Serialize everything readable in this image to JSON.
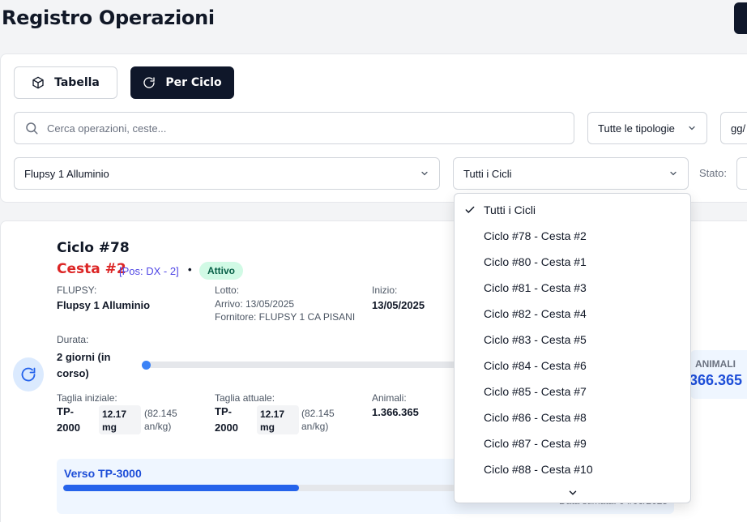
{
  "page_title": "Registro Operazioni",
  "view_toggle": {
    "table_label": "Tabella",
    "cycle_label": "Per Ciclo"
  },
  "filters": {
    "search_placeholder": "Cerca operazioni, ceste...",
    "type_select": "Tutte le tipologie",
    "date_field": "gg/",
    "flupsy_select": "Flupsy 1 Alluminio",
    "cycle_select": "Tutti i Cicli",
    "state_label": "Stato:"
  },
  "cycle_dropdown": {
    "selected": "Tutti i Cicli",
    "options": [
      "Tutti i Cicli",
      "Ciclo #78 - Cesta #2",
      "Ciclo #80 - Cesta #1",
      "Ciclo #81 - Cesta #3",
      "Ciclo #82 - Cesta #4",
      "Ciclo #83 - Cesta #5",
      "Ciclo #84 - Cesta #6",
      "Ciclo #85 - Cesta #7",
      "Ciclo #86 - Cesta #8",
      "Ciclo #87 - Cesta #9",
      "Ciclo #88 - Cesta #10"
    ]
  },
  "cycle_card": {
    "title": "Ciclo #78",
    "basket": "Cesta #2",
    "position": "[Pos: DX - 2]",
    "separator": "•",
    "status": "Attivo",
    "flupsy_label": "FLUPSY:",
    "flupsy_value": "Flupsy 1 Alluminio",
    "lot_label": "Lotto:",
    "lot_arrival": "Arrivo: 13/05/2025",
    "lot_supplier": "Fornitore: FLUPSY 1 CA PISANI",
    "start_label": "Inizio:",
    "start_value": "13/05/2025",
    "duration_label": "Durata:",
    "duration_value_line1": "2 giorni (in",
    "duration_value_line2": "corso)",
    "initial_size_label": "Taglia iniziale:",
    "initial_size_code_1": "TP-",
    "initial_size_code_2": "2000",
    "initial_weight_1": "12.17",
    "initial_weight_2": "mg",
    "initial_per_kg_1": "(82.145",
    "initial_per_kg_2": "an/kg)",
    "current_size_label": "Taglia attuale:",
    "current_size_code_1": "TP-",
    "current_size_code_2": "2000",
    "current_weight_1": "12.17",
    "current_weight_2": "mg",
    "current_per_kg_1": "(82.145",
    "current_per_kg_2": "an/kg)",
    "animals_label": "Animali:",
    "animals_value": "1.366.365",
    "animals_panel_label": "ANIMALI",
    "animals_panel_value": ".366.365",
    "target_label": "Verso TP-3000",
    "target_progress": 0.52,
    "target_estimate": "Data stimata: 04/06/2025"
  },
  "colors": {
    "dark": "#0f172a",
    "basket_red": "#dc2626",
    "accent_blue": "#2563eb",
    "status_green_bg": "#d1fae5"
  }
}
